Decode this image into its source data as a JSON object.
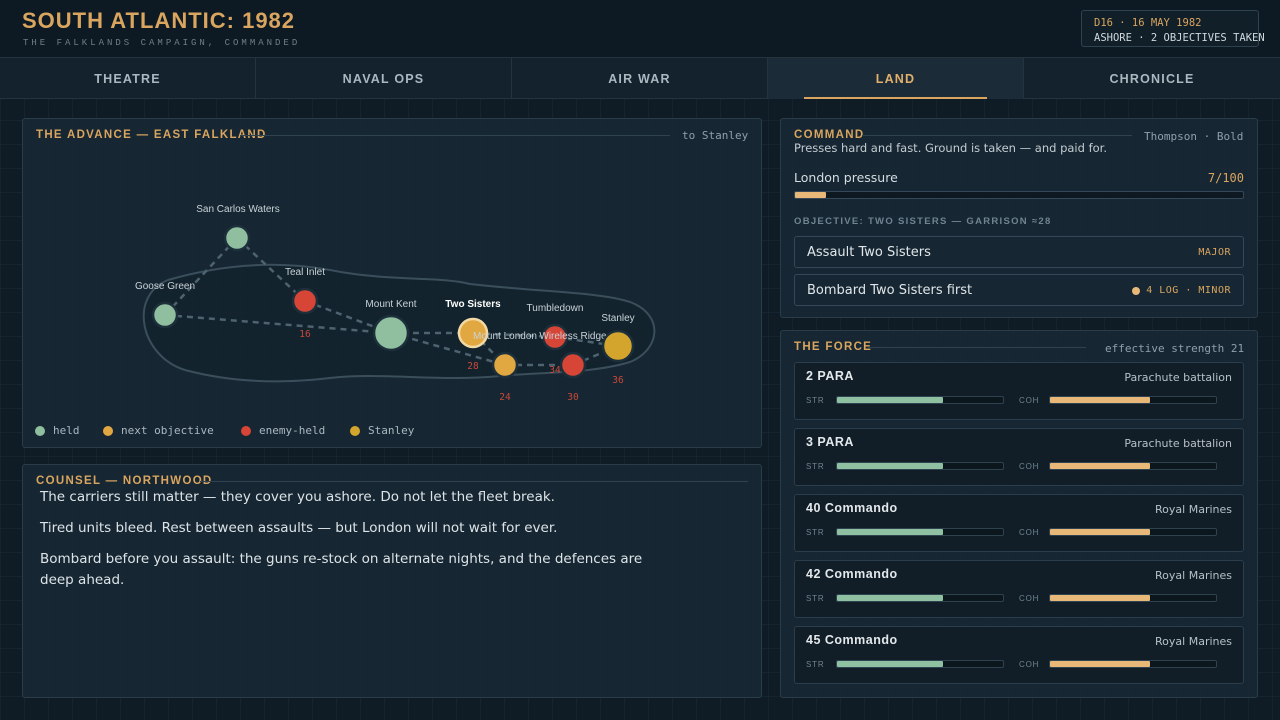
{
  "header": {
    "title": "SOUTH ATLANTIC: 1982",
    "subtitle": "THE FALKLANDS CAMPAIGN, COMMANDED",
    "date": "D16 · 16 MAY 1982",
    "status": "ASHORE · 2 OBJECTIVES TAKEN"
  },
  "tabs": [
    {
      "label": "THEATRE",
      "active": false
    },
    {
      "label": "NAVAL OPS",
      "active": false
    },
    {
      "label": "AIR WAR",
      "active": false
    },
    {
      "label": "LAND",
      "active": true
    },
    {
      "label": "CHRONICLE",
      "active": false
    }
  ],
  "map": {
    "title": "THE ADVANCE — EAST FALKLAND",
    "meta": "to Stanley",
    "colors": {
      "held": "#8fbf9f",
      "next": "#e1a841",
      "enemy": "#d64535",
      "stanley": "#d4a52c"
    },
    "locations": [
      {
        "name": "San Carlos Waters",
        "status": "held",
        "garrison": ""
      },
      {
        "name": "Goose Green",
        "status": "held",
        "garrison": ""
      },
      {
        "name": "Teal Inlet",
        "status": "enemy",
        "garrison": "16"
      },
      {
        "name": "Mount Kent",
        "status": "held",
        "garrison": ""
      },
      {
        "name": "Two Sisters",
        "status": "next",
        "garrison": "28"
      },
      {
        "name": "Mount London",
        "status": "next",
        "garrison": "24"
      },
      {
        "name": "Tumbledown",
        "status": "enemy",
        "garrison": "34"
      },
      {
        "name": "Wireless Ridge",
        "status": "enemy",
        "garrison": "30"
      },
      {
        "name": "Stanley",
        "status": "stanley",
        "garrison": "36"
      }
    ],
    "legend": [
      {
        "label": "held",
        "color": "#8fbf9f"
      },
      {
        "label": "next objective",
        "color": "#e1a841"
      },
      {
        "label": "enemy-held",
        "color": "#d64535"
      },
      {
        "label": "Stanley",
        "color": "#d4a52c"
      }
    ]
  },
  "counsel": {
    "title": "COUNSEL — NORTHWOOD",
    "paragraphs": [
      "The carriers still matter — they cover you ashore. Do not let the fleet break.",
      "Tired units bleed. Rest between assaults — but London will not wait for ever.",
      "Bombard before you assault: the guns re-stock on alternate nights, and the defences are deep ahead."
    ]
  },
  "command": {
    "title": "COMMAND",
    "meta": "Thompson · Bold",
    "description": "Presses hard and fast. Ground is taken — and paid for.",
    "pressure_label": "London pressure",
    "pressure_value": "7/100",
    "pressure_fraction": 0.07,
    "objective_label": "OBJECTIVE: TWO SISTERS — GARRISON ≈28",
    "options": [
      {
        "label": "Assault Two Sisters",
        "tag": "MAJOR",
        "log": false
      },
      {
        "label": "Bombard Two Sisters first",
        "tag": "4 LOG · MINOR",
        "log": true
      }
    ]
  },
  "force": {
    "title": "THE FORCE",
    "meta": "effective strength 21",
    "str_label": "STR",
    "coh_label": "COH",
    "units": [
      {
        "name": "2 PARA",
        "type": "Parachute battalion",
        "str": 0.64,
        "coh": 0.6
      },
      {
        "name": "3 PARA",
        "type": "Parachute battalion",
        "str": 0.64,
        "coh": 0.6
      },
      {
        "name": "40 Commando",
        "type": "Royal Marines",
        "str": 0.64,
        "coh": 0.6
      },
      {
        "name": "42 Commando",
        "type": "Royal Marines",
        "str": 0.64,
        "coh": 0.6
      },
      {
        "name": "45 Commando",
        "type": "Royal Marines",
        "str": 0.64,
        "coh": 0.6
      }
    ]
  }
}
